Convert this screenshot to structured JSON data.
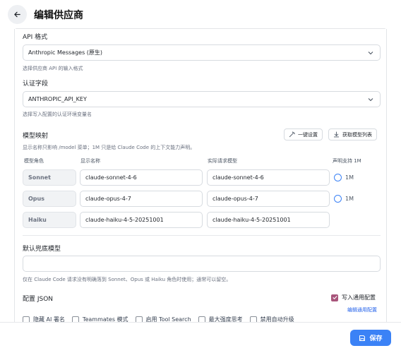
{
  "header": {
    "title": "编辑供应商",
    "back_icon": "arrow-left-icon"
  },
  "api_format": {
    "label": "API 格式",
    "value": "Anthropic Messages (原生)",
    "helper": "选择供应商 API 的输入格式"
  },
  "auth_field": {
    "label": "认证字段",
    "value": "ANTHROPIC_API_KEY",
    "helper": "选择写入配置的认证环境变量名"
  },
  "model_mapping": {
    "label": "模型映射",
    "helper": "显示名称只影响 /model 菜单；1M 只是给 Claude Code 的上下文能力声明。",
    "one_click_label": "一键设置",
    "fetch_list_label": "获取模型列表",
    "columns": {
      "role": "模型角色",
      "display": "显示名称",
      "actual": "实际请求模型",
      "support": "声明支持 1M"
    },
    "rows": [
      {
        "role": "Sonnet",
        "display": "claude-sonnet-4-6",
        "actual": "claude-sonnet-4-6",
        "radio_label": "1M"
      },
      {
        "role": "Opus",
        "display": "claude-opus-4-7",
        "actual": "claude-opus-4-7",
        "radio_label": "1M"
      },
      {
        "role": "Haiku",
        "display": "claude-haiku-4-5-20251001",
        "actual": "claude-haiku-4-5-20251001"
      }
    ]
  },
  "fallback_model": {
    "label": "默认兜底模型",
    "value": "",
    "helper": "仅在 Claude Code 请求没有明确落到 Sonnet、Opus 或 Haiku 角色时使用；通常可以留空。"
  },
  "config_json": {
    "label": "配置 JSON",
    "write_common_label": "写入通用配置",
    "write_common_checked": true,
    "edit_common_link": "编辑通用配置",
    "options": [
      "隐藏 AI 署名",
      "Teammates 模式",
      "启用 Tool Search",
      "最大强度思考",
      "禁用自动升级"
    ]
  },
  "footer": {
    "save_label": "保存"
  },
  "colors": {
    "accent": "#3b82f6",
    "checkbox_checked": "#a8557b",
    "link": "#2563eb"
  }
}
